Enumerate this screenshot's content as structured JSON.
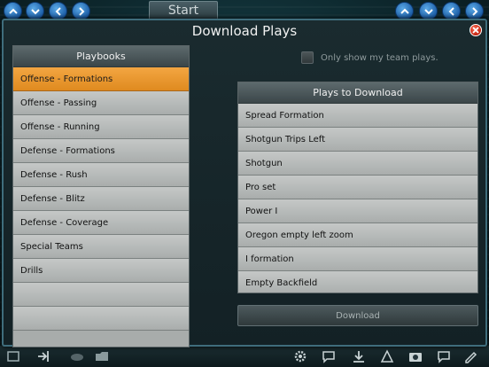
{
  "topbar": {
    "start_label": "Start",
    "left_buttons": [
      "up-icon",
      "down-icon",
      "left-icon",
      "right-icon"
    ],
    "right_buttons": [
      "up-icon",
      "down-icon",
      "left-icon",
      "right-icon"
    ]
  },
  "modal": {
    "title": "Download Plays",
    "close_icon": "close-icon"
  },
  "filter": {
    "only_my_team_label": "Only show my team plays.",
    "checked": false
  },
  "playbooks": {
    "header": "Playbooks",
    "items": [
      "Offense - Formations",
      "Offense - Passing",
      "Offense - Running",
      "Defense - Formations",
      "Defense - Rush",
      "Defense - Blitz",
      "Defense - Coverage",
      "Special Teams",
      "Drills",
      "",
      ""
    ],
    "selected_index": 0
  },
  "plays": {
    "header": "Plays to Download",
    "items": [
      "Spread Formation",
      "Shotgun Trips Left",
      "Shotgun",
      "Pro set",
      "Power I",
      "Oregon empty left zoom",
      "I formation",
      "Empty Backfield"
    ]
  },
  "download_label": "Download",
  "colors": {
    "selected_row": "#e8961f",
    "accent_blue": "#2f7cc9",
    "close_red": "#d8321a"
  }
}
